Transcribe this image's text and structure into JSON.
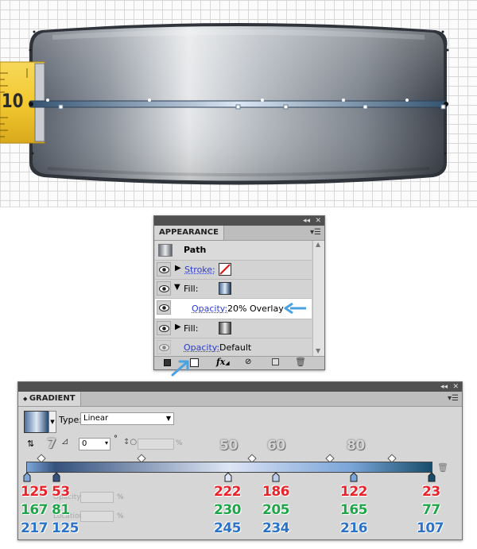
{
  "artboard": {
    "tape_label": "10"
  },
  "appearance": {
    "tab_label": "APPEARANCE",
    "title_controls": {
      "collapse": "◂◂",
      "close": "✕"
    },
    "header": "Path",
    "rows": [
      {
        "label": "Stroke:",
        "kind": "stroke"
      },
      {
        "label": "Fill:",
        "kind": "fill-gradient"
      },
      {
        "label": "Opacity:",
        "value": "20% Overlay",
        "kind": "opacity"
      },
      {
        "label": "Fill:",
        "kind": "fill-gray"
      },
      {
        "label": "Opacity:",
        "value": "Default",
        "kind": "opacity-default"
      }
    ],
    "footer_icons": [
      "square-icon",
      "new-item-icon",
      "fx-icon",
      "clear-icon",
      "duplicate-icon",
      "trash-icon"
    ]
  },
  "gradient": {
    "tab_label": "GRADIENT",
    "type_label": "Type:",
    "type_value": "Linear",
    "angle_value": "0",
    "degree_symbol": "°",
    "percent": "%",
    "callouts": {
      "angle": "7",
      "pos50": "50",
      "pos60": "60",
      "pos80": "80"
    },
    "stops": [
      {
        "r": "125",
        "g": "167",
        "b": "217"
      },
      {
        "r": "53",
        "g": "81",
        "b": "125"
      },
      {
        "r": "222",
        "g": "230",
        "b": "245"
      },
      {
        "r": "186",
        "g": "205",
        "b": "234"
      },
      {
        "r": "122",
        "g": "165",
        "b": "216"
      },
      {
        "r": "23",
        "g": "77",
        "b": "107"
      }
    ],
    "disabled_labels": {
      "opacity": "Opacity:",
      "location": "Location:"
    },
    "colors": {
      "red": "#e8232b",
      "green": "#21a54a",
      "blue": "#2b72c9"
    }
  }
}
